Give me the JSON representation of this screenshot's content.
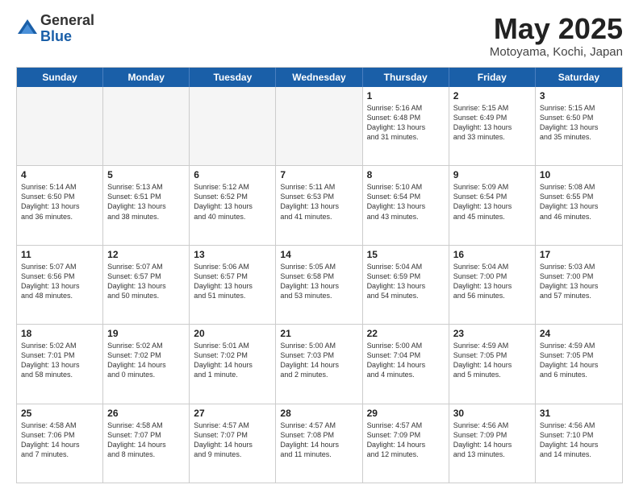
{
  "logo": {
    "general": "General",
    "blue": "Blue"
  },
  "title": "May 2025",
  "location": "Motoyama, Kochi, Japan",
  "weekdays": [
    "Sunday",
    "Monday",
    "Tuesday",
    "Wednesday",
    "Thursday",
    "Friday",
    "Saturday"
  ],
  "weeks": [
    [
      {
        "day": "",
        "info": ""
      },
      {
        "day": "",
        "info": ""
      },
      {
        "day": "",
        "info": ""
      },
      {
        "day": "",
        "info": ""
      },
      {
        "day": "1",
        "info": "Sunrise: 5:16 AM\nSunset: 6:48 PM\nDaylight: 13 hours\nand 31 minutes."
      },
      {
        "day": "2",
        "info": "Sunrise: 5:15 AM\nSunset: 6:49 PM\nDaylight: 13 hours\nand 33 minutes."
      },
      {
        "day": "3",
        "info": "Sunrise: 5:15 AM\nSunset: 6:50 PM\nDaylight: 13 hours\nand 35 minutes."
      }
    ],
    [
      {
        "day": "4",
        "info": "Sunrise: 5:14 AM\nSunset: 6:50 PM\nDaylight: 13 hours\nand 36 minutes."
      },
      {
        "day": "5",
        "info": "Sunrise: 5:13 AM\nSunset: 6:51 PM\nDaylight: 13 hours\nand 38 minutes."
      },
      {
        "day": "6",
        "info": "Sunrise: 5:12 AM\nSunset: 6:52 PM\nDaylight: 13 hours\nand 40 minutes."
      },
      {
        "day": "7",
        "info": "Sunrise: 5:11 AM\nSunset: 6:53 PM\nDaylight: 13 hours\nand 41 minutes."
      },
      {
        "day": "8",
        "info": "Sunrise: 5:10 AM\nSunset: 6:54 PM\nDaylight: 13 hours\nand 43 minutes."
      },
      {
        "day": "9",
        "info": "Sunrise: 5:09 AM\nSunset: 6:54 PM\nDaylight: 13 hours\nand 45 minutes."
      },
      {
        "day": "10",
        "info": "Sunrise: 5:08 AM\nSunset: 6:55 PM\nDaylight: 13 hours\nand 46 minutes."
      }
    ],
    [
      {
        "day": "11",
        "info": "Sunrise: 5:07 AM\nSunset: 6:56 PM\nDaylight: 13 hours\nand 48 minutes."
      },
      {
        "day": "12",
        "info": "Sunrise: 5:07 AM\nSunset: 6:57 PM\nDaylight: 13 hours\nand 50 minutes."
      },
      {
        "day": "13",
        "info": "Sunrise: 5:06 AM\nSunset: 6:57 PM\nDaylight: 13 hours\nand 51 minutes."
      },
      {
        "day": "14",
        "info": "Sunrise: 5:05 AM\nSunset: 6:58 PM\nDaylight: 13 hours\nand 53 minutes."
      },
      {
        "day": "15",
        "info": "Sunrise: 5:04 AM\nSunset: 6:59 PM\nDaylight: 13 hours\nand 54 minutes."
      },
      {
        "day": "16",
        "info": "Sunrise: 5:04 AM\nSunset: 7:00 PM\nDaylight: 13 hours\nand 56 minutes."
      },
      {
        "day": "17",
        "info": "Sunrise: 5:03 AM\nSunset: 7:00 PM\nDaylight: 13 hours\nand 57 minutes."
      }
    ],
    [
      {
        "day": "18",
        "info": "Sunrise: 5:02 AM\nSunset: 7:01 PM\nDaylight: 13 hours\nand 58 minutes."
      },
      {
        "day": "19",
        "info": "Sunrise: 5:02 AM\nSunset: 7:02 PM\nDaylight: 14 hours\nand 0 minutes."
      },
      {
        "day": "20",
        "info": "Sunrise: 5:01 AM\nSunset: 7:02 PM\nDaylight: 14 hours\nand 1 minute."
      },
      {
        "day": "21",
        "info": "Sunrise: 5:00 AM\nSunset: 7:03 PM\nDaylight: 14 hours\nand 2 minutes."
      },
      {
        "day": "22",
        "info": "Sunrise: 5:00 AM\nSunset: 7:04 PM\nDaylight: 14 hours\nand 4 minutes."
      },
      {
        "day": "23",
        "info": "Sunrise: 4:59 AM\nSunset: 7:05 PM\nDaylight: 14 hours\nand 5 minutes."
      },
      {
        "day": "24",
        "info": "Sunrise: 4:59 AM\nSunset: 7:05 PM\nDaylight: 14 hours\nand 6 minutes."
      }
    ],
    [
      {
        "day": "25",
        "info": "Sunrise: 4:58 AM\nSunset: 7:06 PM\nDaylight: 14 hours\nand 7 minutes."
      },
      {
        "day": "26",
        "info": "Sunrise: 4:58 AM\nSunset: 7:07 PM\nDaylight: 14 hours\nand 8 minutes."
      },
      {
        "day": "27",
        "info": "Sunrise: 4:57 AM\nSunset: 7:07 PM\nDaylight: 14 hours\nand 9 minutes."
      },
      {
        "day": "28",
        "info": "Sunrise: 4:57 AM\nSunset: 7:08 PM\nDaylight: 14 hours\nand 11 minutes."
      },
      {
        "day": "29",
        "info": "Sunrise: 4:57 AM\nSunset: 7:09 PM\nDaylight: 14 hours\nand 12 minutes."
      },
      {
        "day": "30",
        "info": "Sunrise: 4:56 AM\nSunset: 7:09 PM\nDaylight: 14 hours\nand 13 minutes."
      },
      {
        "day": "31",
        "info": "Sunrise: 4:56 AM\nSunset: 7:10 PM\nDaylight: 14 hours\nand 14 minutes."
      }
    ]
  ]
}
